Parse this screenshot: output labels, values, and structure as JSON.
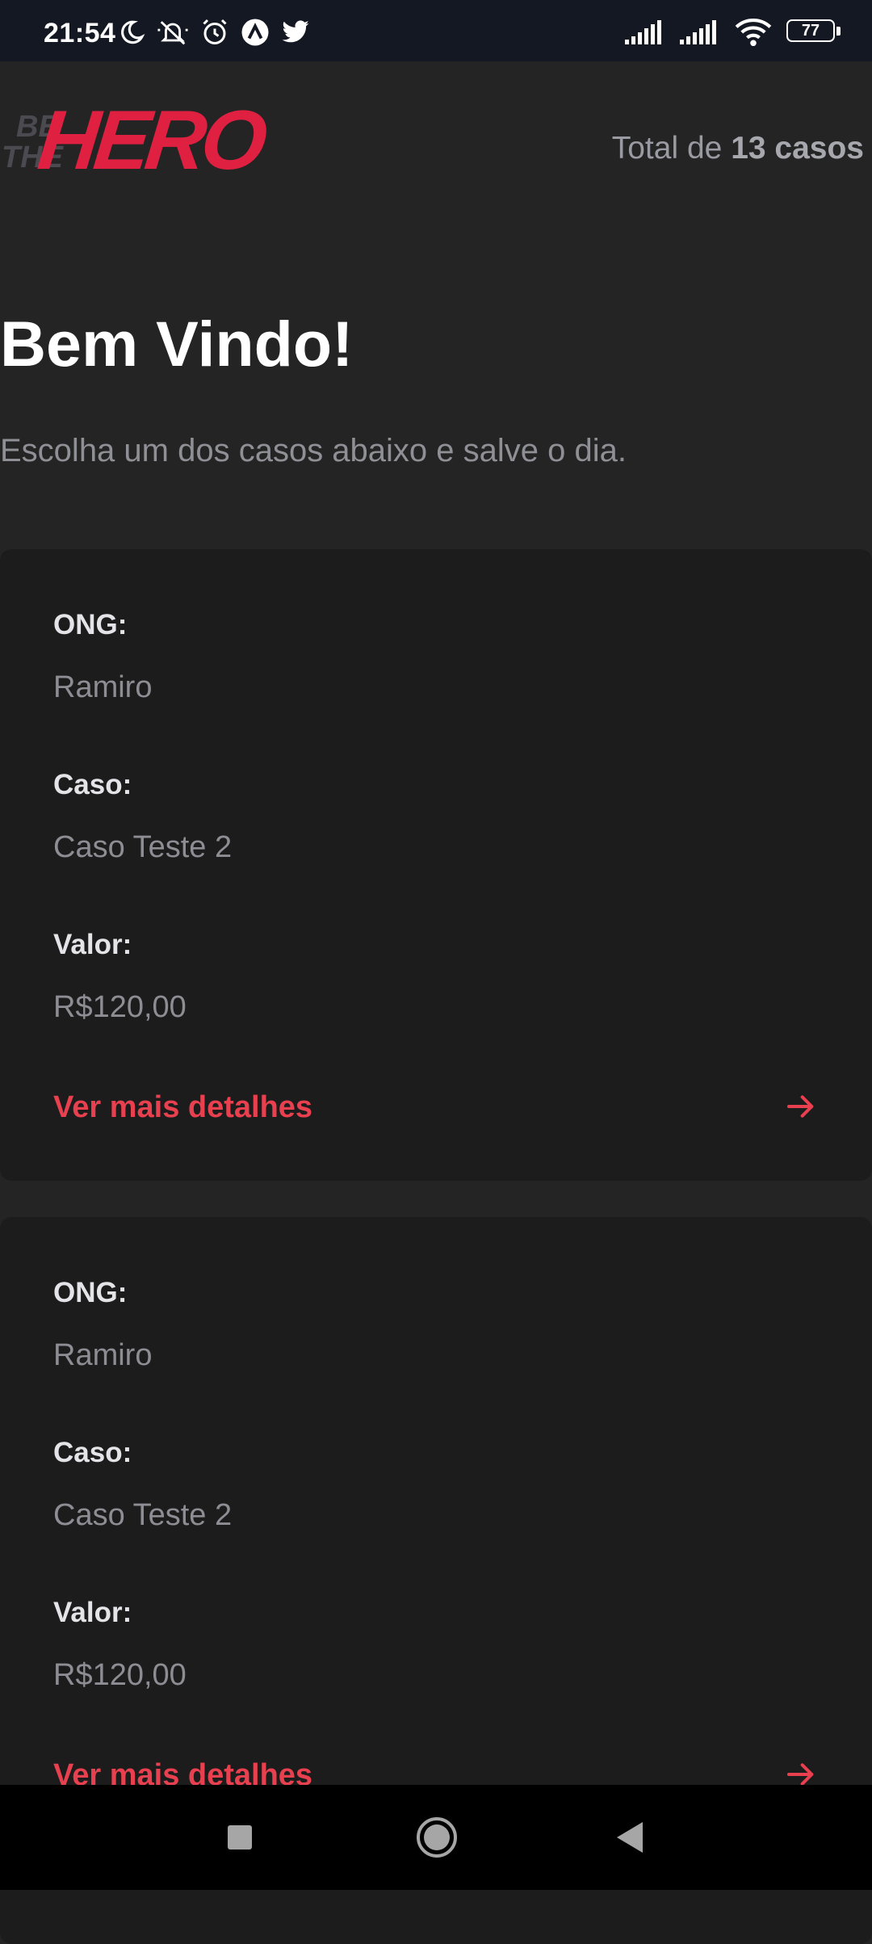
{
  "status_bar": {
    "time": "21:54",
    "battery": "77",
    "icons_left": [
      "moon-icon",
      "bell-off-icon",
      "alarm-icon",
      "a-badge-icon",
      "twitter-icon"
    ],
    "icons_right": [
      "signal-icon",
      "signal-icon",
      "wifi-icon",
      "battery-icon"
    ]
  },
  "header": {
    "logo_top": "BE",
    "logo_mid": "THE",
    "logo_main": "HERO",
    "total_prefix": "Total de",
    "total_count": "13 casos",
    "brand_color": "#e02041"
  },
  "main": {
    "title": "Bem Vindo!",
    "subtitle": "Escolha um dos casos abaixo e salve o dia."
  },
  "incidents": [
    {
      "ong_label": "ONG:",
      "ong": "Ramiro",
      "case_label": "Caso:",
      "case": "Caso Teste 2",
      "value_label": "Valor:",
      "value": "R$120,00",
      "details_label": "Ver mais detalhes"
    },
    {
      "ong_label": "ONG:",
      "ong": "Ramiro",
      "case_label": "Caso:",
      "case": "Caso Teste 2",
      "value_label": "Valor:",
      "value": "R$120,00",
      "details_label": "Ver mais detalhes"
    }
  ],
  "nav_bar": {
    "buttons": [
      "recents-square-icon",
      "home-circle-icon",
      "back-triangle-icon"
    ]
  }
}
